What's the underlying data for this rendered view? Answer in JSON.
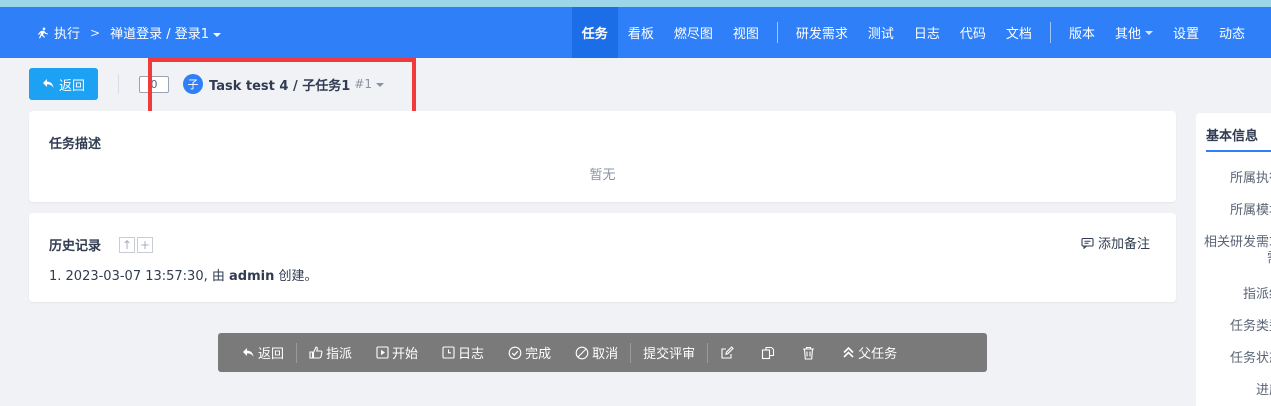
{
  "nav": {
    "breadcrumb_root": "执行",
    "breadcrumb_current": "禅道登录 / 登录1",
    "items": [
      {
        "label": "任务",
        "active": true
      },
      {
        "label": "看板"
      },
      {
        "label": "燃尽图"
      },
      {
        "label": "视图"
      },
      {
        "label": "研发需求"
      },
      {
        "label": "测试"
      },
      {
        "label": "日志"
      },
      {
        "label": "代码"
      },
      {
        "label": "文档"
      },
      {
        "label": "版本"
      },
      {
        "label": "其他"
      },
      {
        "label": "设置"
      },
      {
        "label": "动态"
      }
    ]
  },
  "toolbar": {
    "back_label": "返回",
    "id_value": "0",
    "badge": "子",
    "title": "Task test 4 / 子任务1",
    "number": "#1"
  },
  "desc": {
    "title": "任务描述",
    "empty": "暂无"
  },
  "history": {
    "title": "历史记录",
    "add_note": "添加备注",
    "entry_prefix": "1. 2023-03-07 13:57:30, 由 ",
    "entry_user": "admin",
    "entry_suffix": " 创建。"
  },
  "actions": {
    "back": "返回",
    "assign": "指派",
    "start": "开始",
    "log": "日志",
    "finish": "完成",
    "cancel": "取消",
    "review": "提交评审",
    "parent": "父任务"
  },
  "side": {
    "tab": "基本信息",
    "labels": [
      "所属执行",
      "所属模块",
      "相关研发需求",
      "需",
      "指派给",
      "任务类型",
      "任务状态",
      "进度"
    ]
  },
  "colors": {
    "nav_bg": "#2e7ff8",
    "accent": "#1da1f2",
    "highlight": "#f23a3a"
  }
}
